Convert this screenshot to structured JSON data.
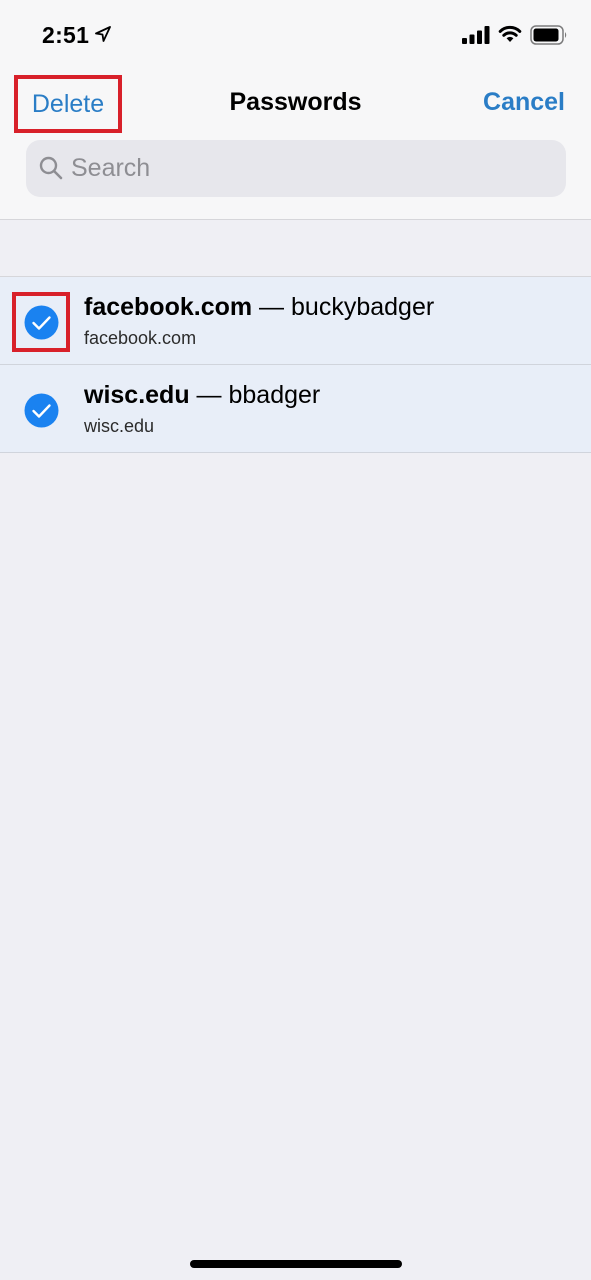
{
  "status_bar": {
    "time": "2:51",
    "icons": [
      "location-arrow-icon",
      "signal-icon",
      "wifi-icon",
      "battery-icon"
    ]
  },
  "nav": {
    "delete_label": "Delete",
    "title": "Passwords",
    "cancel_label": "Cancel"
  },
  "search": {
    "placeholder": "Search",
    "value": ""
  },
  "passwords": [
    {
      "domain": "facebook.com",
      "separator": " — ",
      "username": "buckybadger",
      "subtitle": "facebook.com",
      "selected": true
    },
    {
      "domain": "wisc.edu",
      "separator": " — ",
      "username": "bbadger",
      "subtitle": "wisc.edu",
      "selected": true
    }
  ],
  "colors": {
    "accent": "#2a7dc6",
    "checkbox": "#1a82f0",
    "highlight_box": "#d8202a",
    "selected_row": "#e8eef8",
    "background": "#efeff4"
  }
}
